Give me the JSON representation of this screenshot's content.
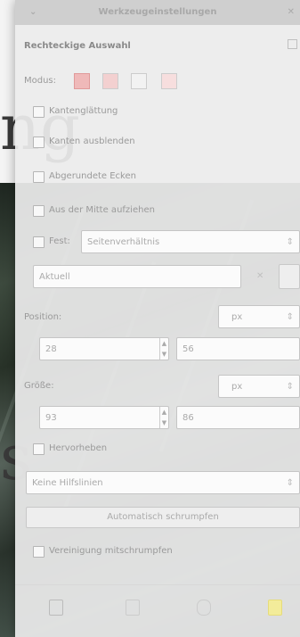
{
  "background": {
    "text_top": "ng",
    "text_bottom": "s"
  },
  "dialog": {
    "title": "Werkzeugeinstellungen",
    "section": "Rechteckige Auswahl",
    "mode_label": "Modus:",
    "antialiasing": "Kantenglättung",
    "feather_edges": "Kanten ausblenden",
    "rounded_corners": "Abgerundete Ecken",
    "expand_from_center": "Aus der Mitte aufziehen",
    "fixed": "Fest:",
    "fixed_option": "Seitenverhältnis",
    "fixed_value": "Aktuell",
    "position_label": "Position:",
    "position_unit": "px",
    "position_x": "28",
    "position_y": "56",
    "size_label": "Größe:",
    "size_unit": "px",
    "size_w": "93",
    "size_h": "86",
    "highlight": "Hervorheben",
    "guides": "Keine Hilfslinien",
    "auto_shrink": "Automatisch schrumpfen",
    "shrink_merged": "Vereinigung mitschrumpfen"
  }
}
